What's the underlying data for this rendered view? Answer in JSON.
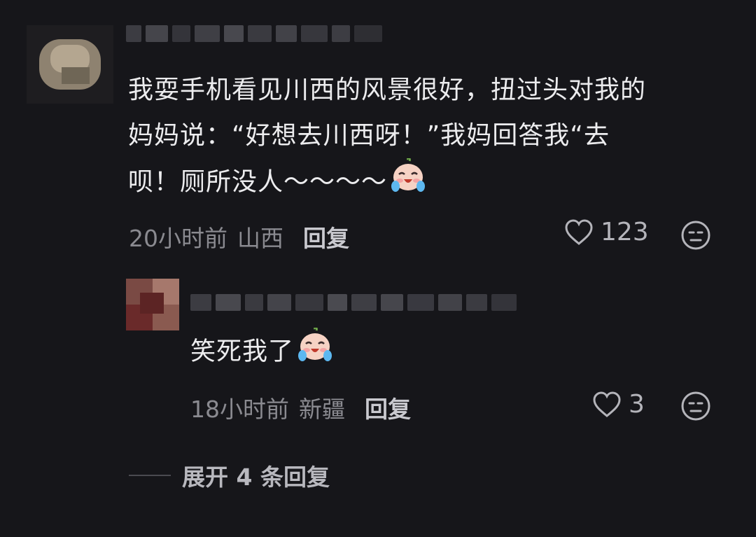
{
  "comment": {
    "lines": [
      "我耍手机看见川西的风景很好，扭过头对我的",
      "妈妈说：“好想去川西呀！”我妈回答我“去",
      "呗！厕所没人～～～～"
    ],
    "emoji": "crying-laughing-sticker",
    "time": "20小时前",
    "location": "山西",
    "reply_label": "回复",
    "like_count": "123"
  },
  "reply": {
    "text": "笑死我了",
    "emoji": "crying-laughing-sticker",
    "time": "18小时前",
    "location": "新疆",
    "reply_label": "回复",
    "like_count": "3"
  },
  "expand_label": "展开 4 条回复",
  "colors": {
    "background": "#16161a",
    "text": "#ececee",
    "meta": "#8a8a90"
  }
}
